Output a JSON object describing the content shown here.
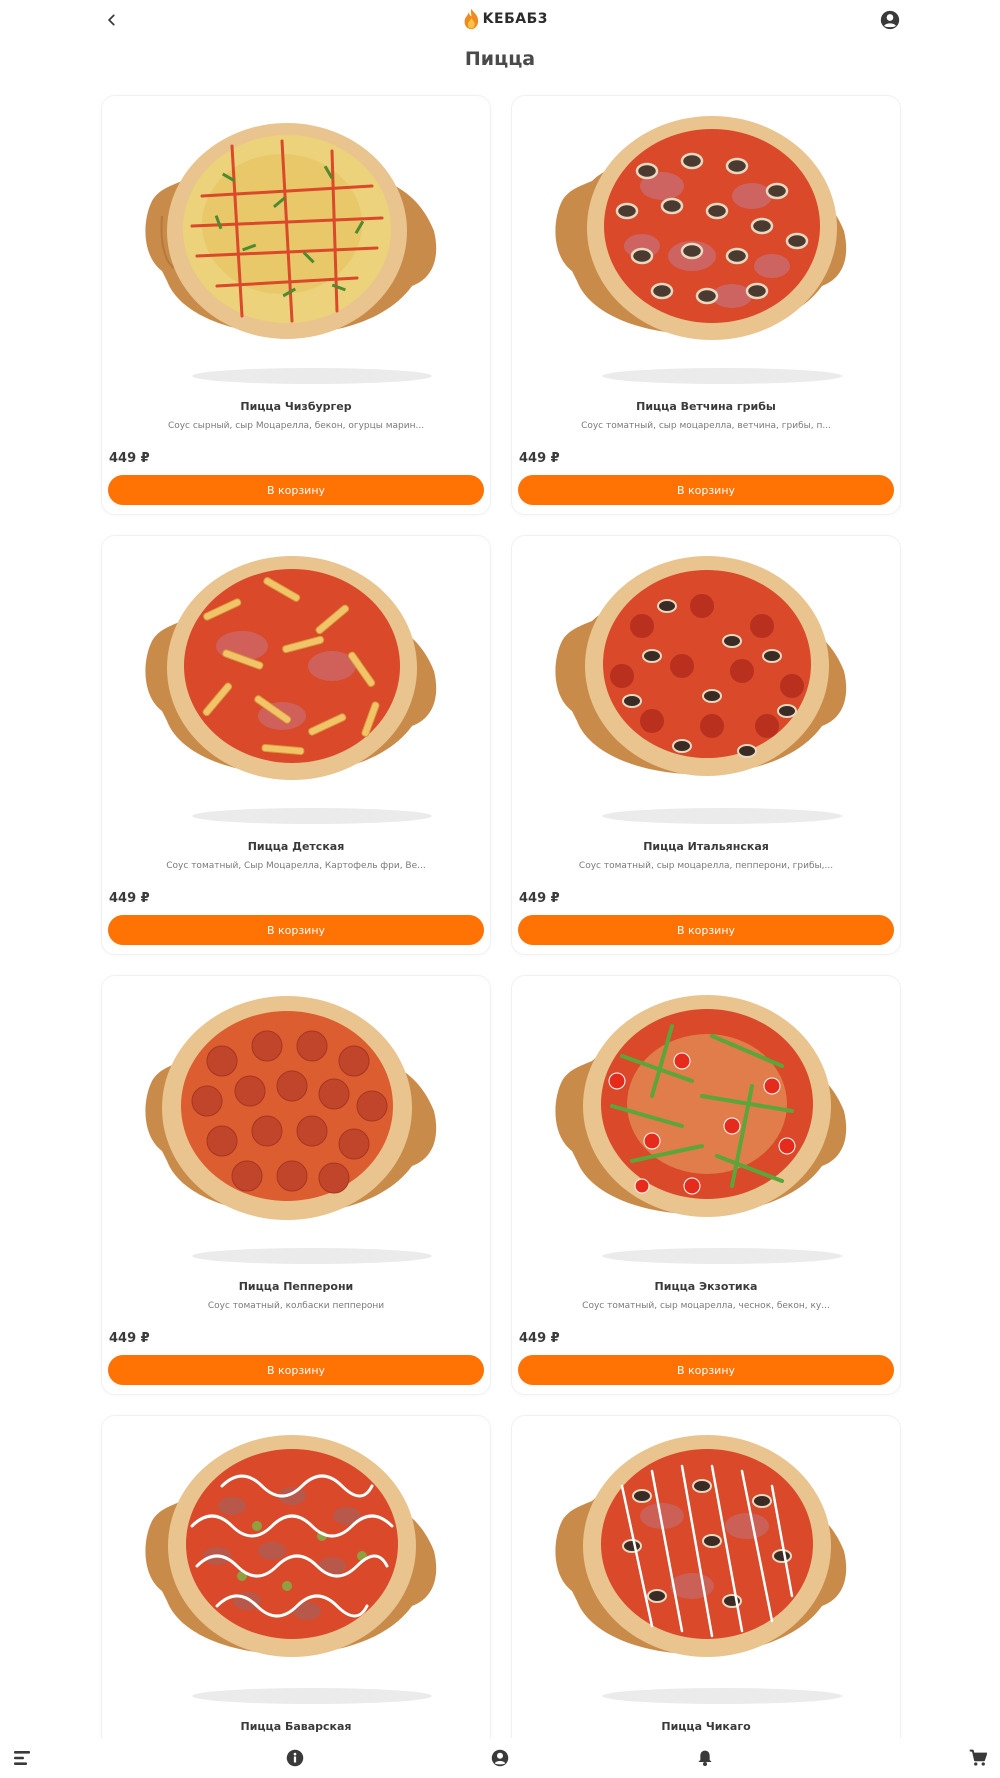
{
  "header": {
    "back_icon": "chevron-left-icon",
    "logo_text": "KEБAБ3",
    "profile_icon": "account-circle-icon"
  },
  "page": {
    "title": "Пицца"
  },
  "products": [
    {
      "name": "Пицца Чизбургер",
      "description": "Соус сырный, сыр Моцарелла, бекон, огурцы марин...",
      "price": "449 ₽",
      "button_label": "В корзину",
      "image_style": "cheeseburger"
    },
    {
      "name": "Пицца Ветчина грибы",
      "description": "Соус томатный, сыр моцарелла, ветчина, грибы, п...",
      "price": "449 ₽",
      "button_label": "В корзину",
      "image_style": "ham-mushroom"
    },
    {
      "name": "Пицца Детская",
      "description": "Соус томатный, Сыр Моцарелла, Картофель фри, Ве...",
      "price": "449 ₽",
      "button_label": "В корзину",
      "image_style": "kids"
    },
    {
      "name": "Пицца Итальянская",
      "description": "Соус томатный, сыр моцарелла, пепперони, грибы,...",
      "price": "449 ₽",
      "button_label": "В корзину",
      "image_style": "italian"
    },
    {
      "name": "Пицца Пепперони",
      "description": "Соус томатный, колбаски пепперони",
      "price": "449 ₽",
      "button_label": "В корзину",
      "image_style": "pepperoni"
    },
    {
      "name": "Пицца Экзотика",
      "description": "Соус томатный, сыр моцарелла, чеснок, бекон, ку...",
      "price": "449 ₽",
      "button_label": "В корзину",
      "image_style": "exotic"
    },
    {
      "name": "Пицца Баварская",
      "image_style": "bavarian"
    },
    {
      "name": "Пицца Чикаго",
      "image_style": "chicago"
    }
  ],
  "bottom_nav": [
    {
      "icon": "menu-icon"
    },
    {
      "icon": "info-icon"
    },
    {
      "icon": "account-circle-icon"
    },
    {
      "icon": "bell-icon"
    },
    {
      "icon": "cart-icon"
    }
  ],
  "colors": {
    "accent": "#ff7203",
    "text": "#3a3a3a",
    "muted": "#7a7a7a",
    "board": "#c98b4a",
    "crust": "#e9c48e",
    "sauce": "#d9492a"
  }
}
